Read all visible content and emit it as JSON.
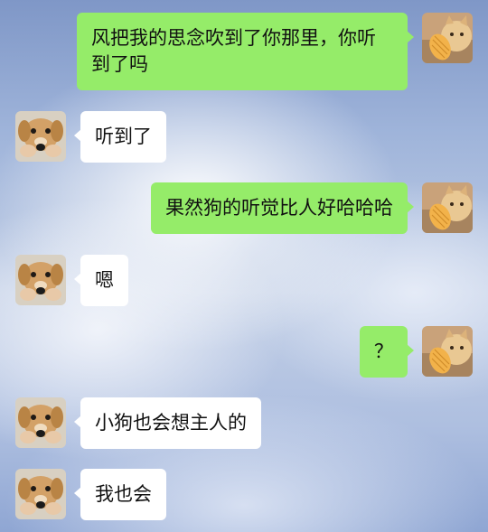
{
  "conversation": {
    "messages": [
      {
        "sender": "me",
        "avatar": "cat-avatar-icon",
        "text": "风把我的思念吹到了你那里，你听到了吗"
      },
      {
        "sender": "other",
        "avatar": "dog-avatar-icon",
        "text": "听到了"
      },
      {
        "sender": "me",
        "avatar": "cat-avatar-icon",
        "text": "果然狗的听觉比人好哈哈哈"
      },
      {
        "sender": "other",
        "avatar": "dog-avatar-icon",
        "text": "嗯"
      },
      {
        "sender": "me",
        "avatar": "cat-avatar-icon",
        "text": "？"
      },
      {
        "sender": "other",
        "avatar": "dog-avatar-icon",
        "text": "小狗也会想主人的"
      },
      {
        "sender": "other",
        "avatar": "dog-avatar-icon",
        "text": "我也会"
      }
    ]
  },
  "colors": {
    "my_bubble": "#95ec69",
    "their_bubble": "#ffffff",
    "sky_top": "#7f97c7",
    "sky_bottom": "#8fa6d3"
  }
}
